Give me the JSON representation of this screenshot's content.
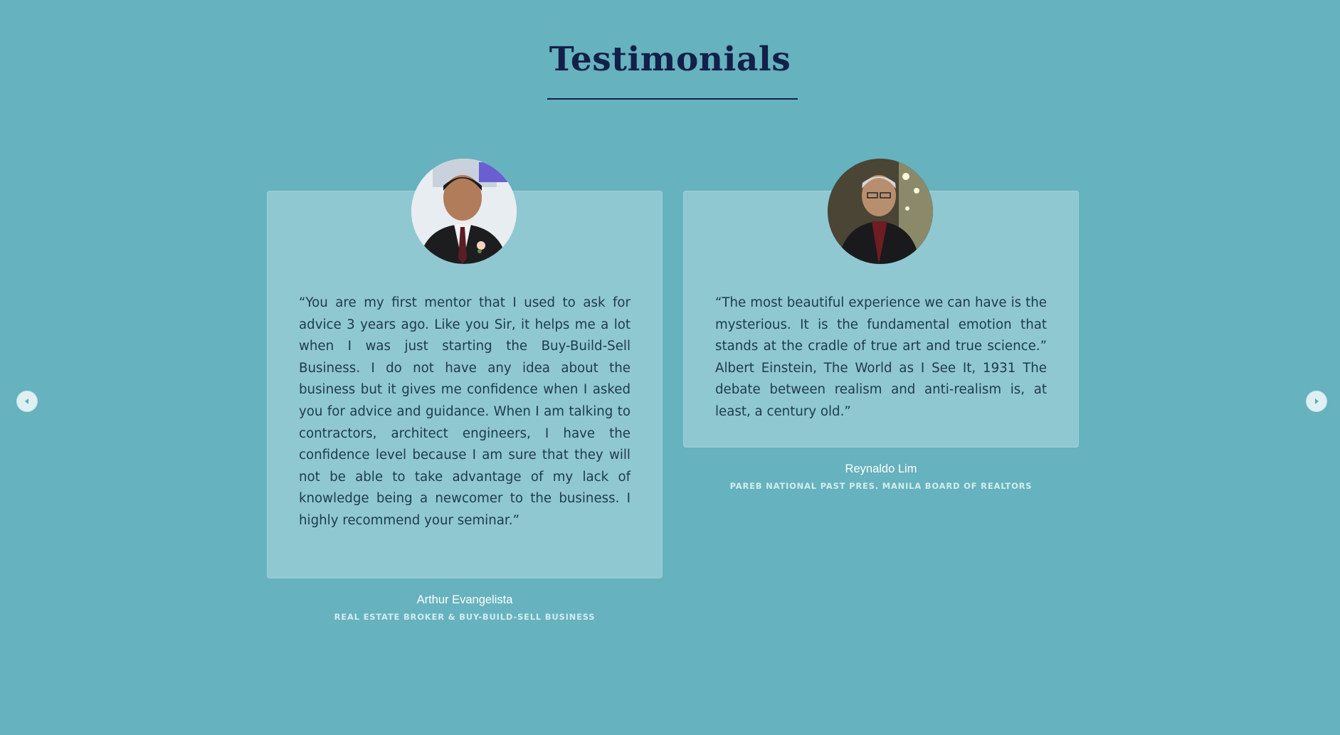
{
  "section": {
    "title": "Testimonials"
  },
  "carousel": {
    "prev_icon": "chevron-left-icon",
    "next_icon": "chevron-right-icon"
  },
  "testimonials": [
    {
      "quote": "“You are my first mentor that I used to ask for advice 3 years ago. Like you Sir, it helps me a lot when I was just starting the Buy-Build-Sell Business. I do not have any idea about the business but it gives me confidence when I asked you for advice and guidance. When I am talking to contractors, architect engineers, I have the confidence level because I am sure that they will not be able to take advantage of my lack of knowledge being a newcomer to the business. I highly recommend your seminar.”",
      "name": "Arthur Evangelista",
      "role": "REAL ESTATE BROKER & BUY-BUILD-SELL BUSINESS"
    },
    {
      "quote": "“The most beautiful experience we can have is the mysterious. It is the fundamental emotion that stands at the cradle of true art and true science.” Albert Einstein, The World as I See It, 1931 The debate between realism and anti-realism is, at least, a century old.”",
      "name": "Reynaldo Lim",
      "role": "PAREB NATIONAL PAST PRES. MANILA BOARD OF REALTORS"
    }
  ],
  "colors": {
    "background": "#66b2be",
    "card": "#8fc8d1",
    "heading": "#12204a"
  }
}
